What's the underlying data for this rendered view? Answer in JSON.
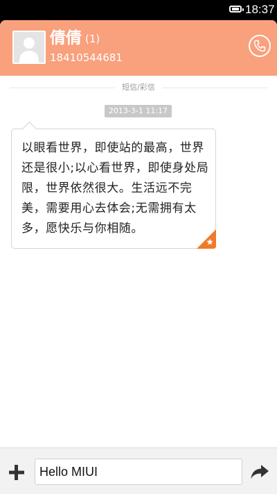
{
  "status_bar": {
    "time": "18:37",
    "battery_icon": "battery-full-icon"
  },
  "header": {
    "avatar_icon": "default-contact-avatar-icon",
    "contact_name": "倩倩",
    "unread_count": "(1)",
    "phone_number": "18410544681",
    "call_icon": "phone-icon",
    "background_color": "#f9a07d"
  },
  "conversation": {
    "channel_label": "短信/彩信",
    "timestamp": "2013-3-1 11:17",
    "messages": [
      {
        "text": "以眼看世界，即使站的最高，世界还是很小;以心看世界，即使身处局限，世界依然很大。生活远不完美，需要用心去体会;无需拥有太多，愿快乐与你相随。",
        "starred": true,
        "star_color": "#f07a2a"
      }
    ]
  },
  "composer": {
    "add_icon": "plus-icon",
    "input_value": "Hello MIUI",
    "send_icon": "send-arrow-icon"
  }
}
